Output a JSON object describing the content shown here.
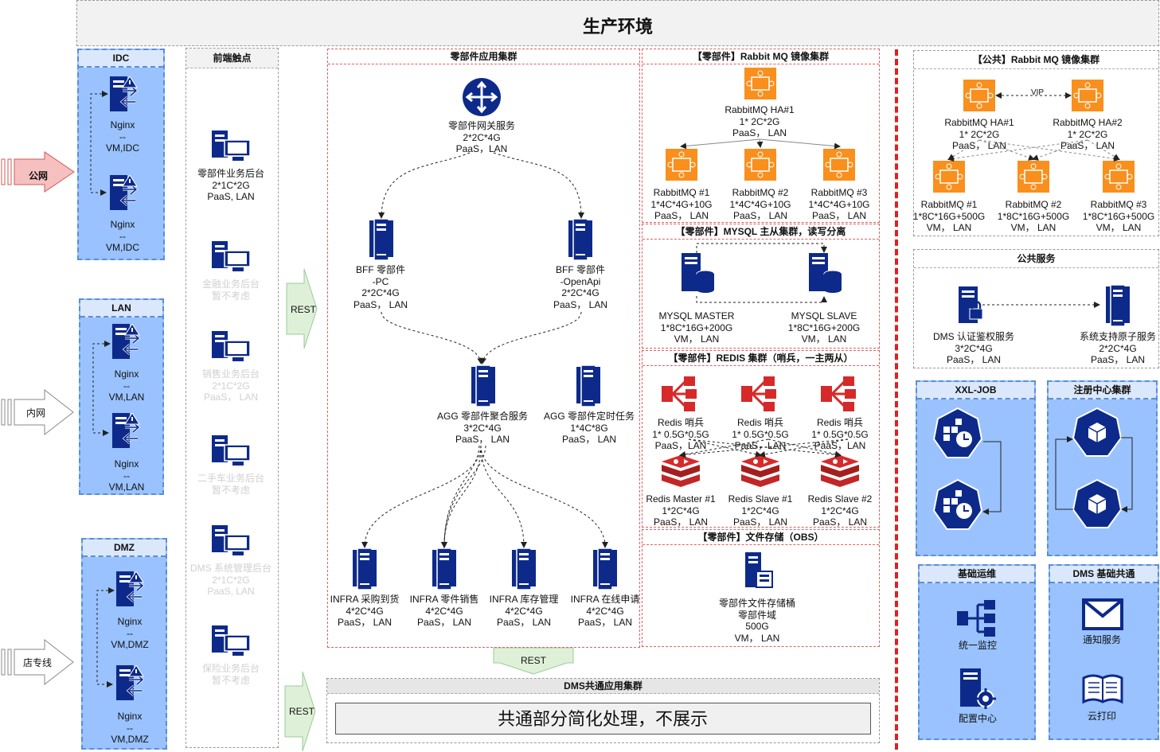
{
  "title": "生产环境",
  "entries": [
    {
      "label": "公网"
    },
    {
      "label": "内网"
    },
    {
      "label": "店专线"
    }
  ],
  "idc": {
    "title": "IDC",
    "nodes": [
      {
        "name": "Nginx",
        "sep": "--",
        "env": "VM,IDC"
      },
      {
        "name": "Nginx",
        "sep": "--",
        "env": "VM,IDC"
      }
    ]
  },
  "lan": {
    "title": "LAN",
    "nodes": [
      {
        "name": "Nginx",
        "sep": "--",
        "env": "VM,LAN"
      },
      {
        "name": "Nginx",
        "sep": "--",
        "env": "VM,LAN"
      }
    ]
  },
  "dmz": {
    "title": "DMZ",
    "nodes": [
      {
        "name": "Nginx",
        "sep": "--",
        "env": "VM,DMZ"
      },
      {
        "name": "Nginx",
        "sep": "--",
        "env": "VM,DMZ"
      }
    ]
  },
  "frontend": {
    "title": "前端触点",
    "items": [
      {
        "lines": [
          "零部件业务后台",
          "2*1C*2G",
          "PaaS, LAN"
        ]
      },
      {
        "lines": [
          "金融业务后台",
          "暂不考虑"
        ]
      },
      {
        "lines": [
          "销售业务后台",
          "2*1C*2G",
          "PaaS， LAN"
        ]
      },
      {
        "lines": [
          "二手车业务后台",
          "暂不考虑"
        ]
      },
      {
        "lines": [
          "DMS 系统管理后台",
          "2*1C*2G",
          "PaaS, LAN"
        ]
      },
      {
        "lines": [
          "保险业务后台",
          "暂不考虑"
        ]
      }
    ]
  },
  "rest": "REST",
  "parts": {
    "title": "零部件应用集群",
    "gateway": [
      "零部件网关服务",
      "2*2C*4G",
      "PaaS，LAN"
    ],
    "bff_pc": [
      "BFF 零部件",
      "-PC",
      "2*2C*4G",
      "PaaS，  LAN"
    ],
    "bff_api": [
      "BFF 零部件",
      "-OpenApi",
      "2*2C*4G",
      "PaaS，  LAN"
    ],
    "agg": [
      "AGG 零部件聚合服务",
      "3*2C*4G",
      "PaaS，  LAN"
    ],
    "agg_task": [
      "AGG 零部件定时任务",
      "1*4C*8G",
      "PaaS，  LAN"
    ],
    "infra": [
      [
        "INFRA 采购到货",
        "4*2C*4G",
        "PaaS，  LAN"
      ],
      [
        "INFRA 零件销售",
        "4*2C*4G",
        "PaaS，  LAN"
      ],
      [
        "INFRA 库存管理",
        "4*2C*4G",
        "PaaS，  LAN"
      ],
      [
        "INFRA 在线申请",
        "4*2C*4G",
        "PaaS，  LAN"
      ]
    ]
  },
  "rabbit": {
    "title": "【零部件】Rabbit MQ 镜像集群",
    "ha": [
      "RabbitMQ HA#1",
      "1* 2C*2G",
      "PaaS，  LAN"
    ],
    "nodes": [
      [
        "RabbitMQ #1",
        "1*4C*4G+10G",
        "PaaS，  LAN"
      ],
      [
        "RabbitMQ #2",
        "1*4C*4G+10G",
        "PaaS，  LAN"
      ],
      [
        "RabbitMQ #3",
        "1*4C*4G+10G",
        "PaaS，  LAN"
      ]
    ]
  },
  "mysql": {
    "title": "【零部件】MYSQL 主从集群，读写分离",
    "master": [
      "MYSQL MASTER",
      "1*8C*16G+200G",
      "VM，  LAN"
    ],
    "slave": [
      "MYSQL SLAVE",
      "1*8C*16G+200G",
      "VM，  LAN"
    ]
  },
  "redis": {
    "title": "【零部件】REDIS 集群（哨兵，一主两从）",
    "sentinels": [
      [
        "Redis  哨兵",
        "1* 0.5G*0.5G",
        "PaaS，LAN"
      ],
      [
        "Redis  哨兵",
        "1* 0.5G*0.5G",
        "PaaS，LAN"
      ],
      [
        "Redis  哨兵",
        "1* 0.5G*0.5G",
        "PaaS，LAN"
      ]
    ],
    "nodes": [
      [
        "Redis Master #1",
        "1*2C*4G",
        "PaaS，  LAN"
      ],
      [
        "Redis Slave #1",
        "1*2C*4G",
        "PaaS，  LAN"
      ],
      [
        "Redis Slave #2",
        "1*2C*4G",
        "PaaS，  LAN"
      ]
    ]
  },
  "obs": {
    "title": "【零部件】文件存储（OBS）",
    "node": [
      "零部件文件存储桶",
      "零部件域",
      "500G",
      "VM，  LAN"
    ]
  },
  "dms_common": {
    "title": "DMS共通应用集群",
    "note": "共通部分简化处理，不展示"
  },
  "pub_rabbit": {
    "title": "【公共】Rabbit MQ 镜像集群",
    "vip": "VIP",
    "ha": [
      [
        "RabbitMQ HA#1",
        "1* 2C*2G",
        "PaaS，  LAN"
      ],
      [
        "RabbitMQ HA#2",
        "1* 2C*2G",
        "PaaS，  LAN"
      ]
    ],
    "nodes": [
      [
        "RabbitMQ #1",
        "1*8C*16G+500G",
        "VM，  LAN"
      ],
      [
        "RabbitMQ #2",
        "1*8C*16G+500G",
        "VM，  LAN"
      ],
      [
        "RabbitMQ #3",
        "1*8C*16G+500G",
        "VM，  LAN"
      ]
    ]
  },
  "pub_service": {
    "title": "公共服务",
    "auth": [
      "DMS 认证鉴权服务",
      "3*2C*4G",
      "PaaS，  LAN"
    ],
    "atom": [
      "系统支持原子服务",
      "2*2C*4G",
      "PaaS，  LAN"
    ]
  },
  "xxljob": {
    "title": "XXL-JOB"
  },
  "registry": {
    "title": "注册中心集群"
  },
  "ops": {
    "title": "基础运维",
    "monitor": "统一监控",
    "config": "配置中心"
  },
  "dms_base": {
    "title": "DMS 基础共通",
    "notify": "通知服务",
    "print": "云打印"
  },
  "colors": {
    "orange": "#f98f1d",
    "navy": "#0d2a8a",
    "red": "#d62a2a",
    "blue": "#99c2ff"
  }
}
